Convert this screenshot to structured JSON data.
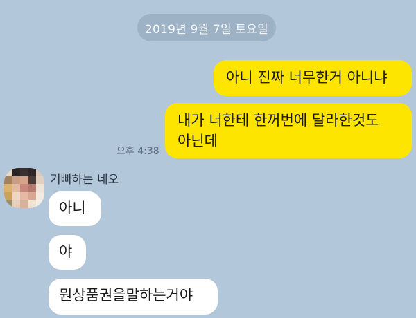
{
  "colors": {
    "background": "#b2c7da",
    "my_bubble": "#fee500",
    "other_bubble": "#ffffff"
  },
  "date_divider": "2019년 9월 7일 토요일",
  "outgoing_messages": [
    {
      "text": "아니 진짜 너무한거 아니냐"
    },
    {
      "lines": [
        "내가 너한테 한꺼번에 달라한것도",
        "아닌데"
      ]
    }
  ],
  "outgoing_time": "오후 4:38",
  "incoming": {
    "sender": "기뻐하는 네오",
    "avatar": "pixelated-profile-photo",
    "messages": [
      "아니",
      "야",
      "뭔상품권을말하는거야"
    ]
  }
}
